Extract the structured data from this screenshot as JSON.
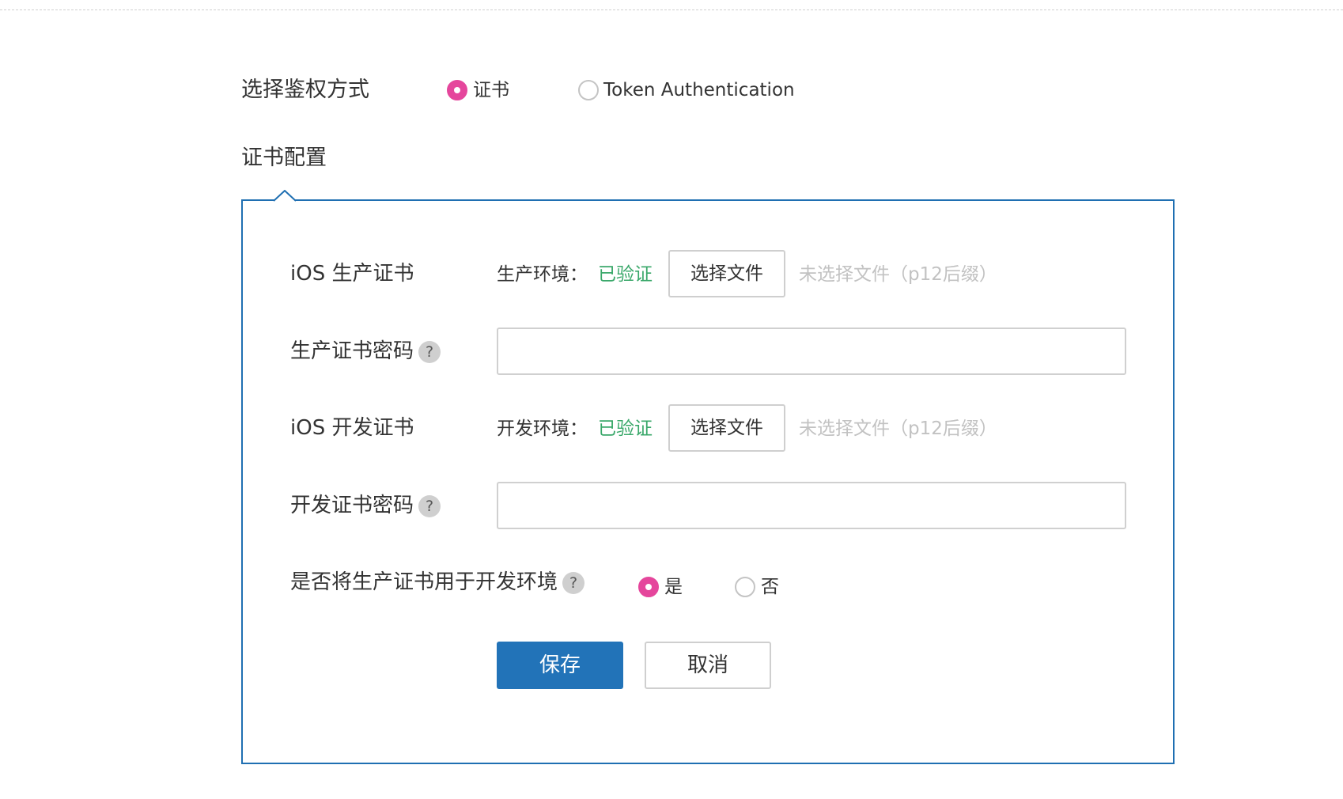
{
  "auth": {
    "label": "选择鉴权方式",
    "options": [
      {
        "label": "证书",
        "checked": true
      },
      {
        "label": "Token Authentication",
        "checked": false
      }
    ]
  },
  "config": {
    "title": "证书配置",
    "prod_cert": {
      "label": "iOS 生产证书",
      "env_label": "生产环境：",
      "status": "已验证",
      "button": "选择文件",
      "hint": "未选择文件（p12后缀）"
    },
    "prod_password": {
      "label": "生产证书密码",
      "help": "?",
      "value": ""
    },
    "dev_cert": {
      "label": "iOS 开发证书",
      "env_label": "开发环境：",
      "status": "已验证",
      "button": "选择文件",
      "hint": "未选择文件（p12后缀）"
    },
    "dev_password": {
      "label": "开发证书密码",
      "help": "?",
      "value": ""
    },
    "use_prod_for_dev": {
      "label": "是否将生产证书用于开发环境",
      "help": "?",
      "options": [
        {
          "label": "是",
          "checked": true
        },
        {
          "label": "否",
          "checked": false
        }
      ]
    },
    "actions": {
      "save": "保存",
      "cancel": "取消"
    }
  },
  "colors": {
    "accent_pink": "#e5469c",
    "primary_blue": "#2273b8",
    "border_blue": "#1f6fb2",
    "verified_green": "#3aa86a",
    "hint_gray": "#c2c2c2"
  }
}
